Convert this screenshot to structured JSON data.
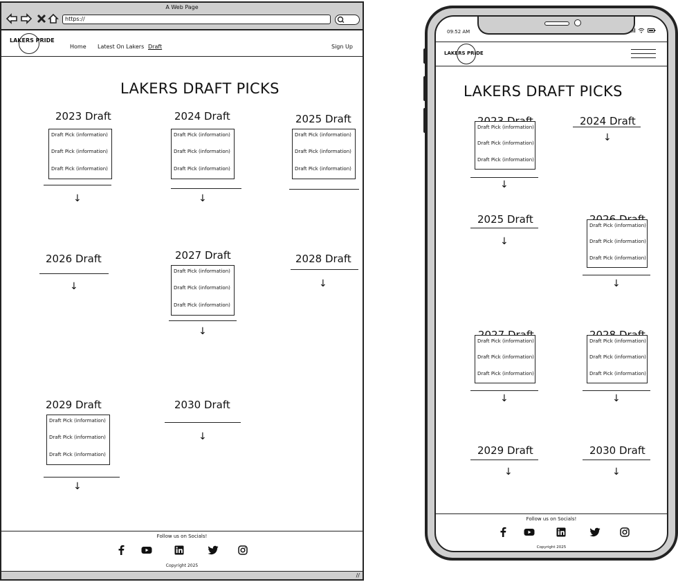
{
  "browser": {
    "window_title": "A Web Page",
    "url": "https://"
  },
  "site": {
    "logo": "LAKERS PRIDE",
    "nav": [
      "Home",
      "Latest On Lakers",
      "Draft"
    ],
    "sign_up": "Sign Up",
    "page_title": "LAKERS DRAFT PICKS",
    "pick_label": "Draft Pick (information)",
    "footer_follow": "Follow us on Socials!",
    "copyright": "Copyright 2025"
  },
  "drafts": [
    {
      "label": "2023 Draft",
      "expanded": true
    },
    {
      "label": "2024 Draft",
      "expanded": true
    },
    {
      "label": "2025 Draft",
      "expanded": true
    },
    {
      "label": "2026 Draft",
      "expanded": false
    },
    {
      "label": "2027 Draft",
      "expanded": true
    },
    {
      "label": "2028 Draft",
      "expanded": false
    },
    {
      "label": "2029 Draft",
      "expanded": true
    },
    {
      "label": "2030 Draft",
      "expanded": false
    }
  ],
  "mobile": {
    "status_time": "09:52 AM",
    "drafts": [
      {
        "label": "2023 Draft",
        "expanded": true
      },
      {
        "label": "2024 Draft",
        "expanded": false
      },
      {
        "label": "2025 Draft",
        "expanded": false
      },
      {
        "label": "2026 Draft",
        "expanded": true
      },
      {
        "label": "2027 Draft",
        "expanded": true
      },
      {
        "label": "2028 Draft",
        "expanded": true
      },
      {
        "label": "2029 Draft",
        "expanded": false
      },
      {
        "label": "2030 Draft",
        "expanded": false
      }
    ]
  },
  "socials": [
    "facebook-icon",
    "youtube-icon",
    "linkedin-icon",
    "twitter-icon",
    "instagram-icon"
  ],
  "arrow_glyph": "↓"
}
